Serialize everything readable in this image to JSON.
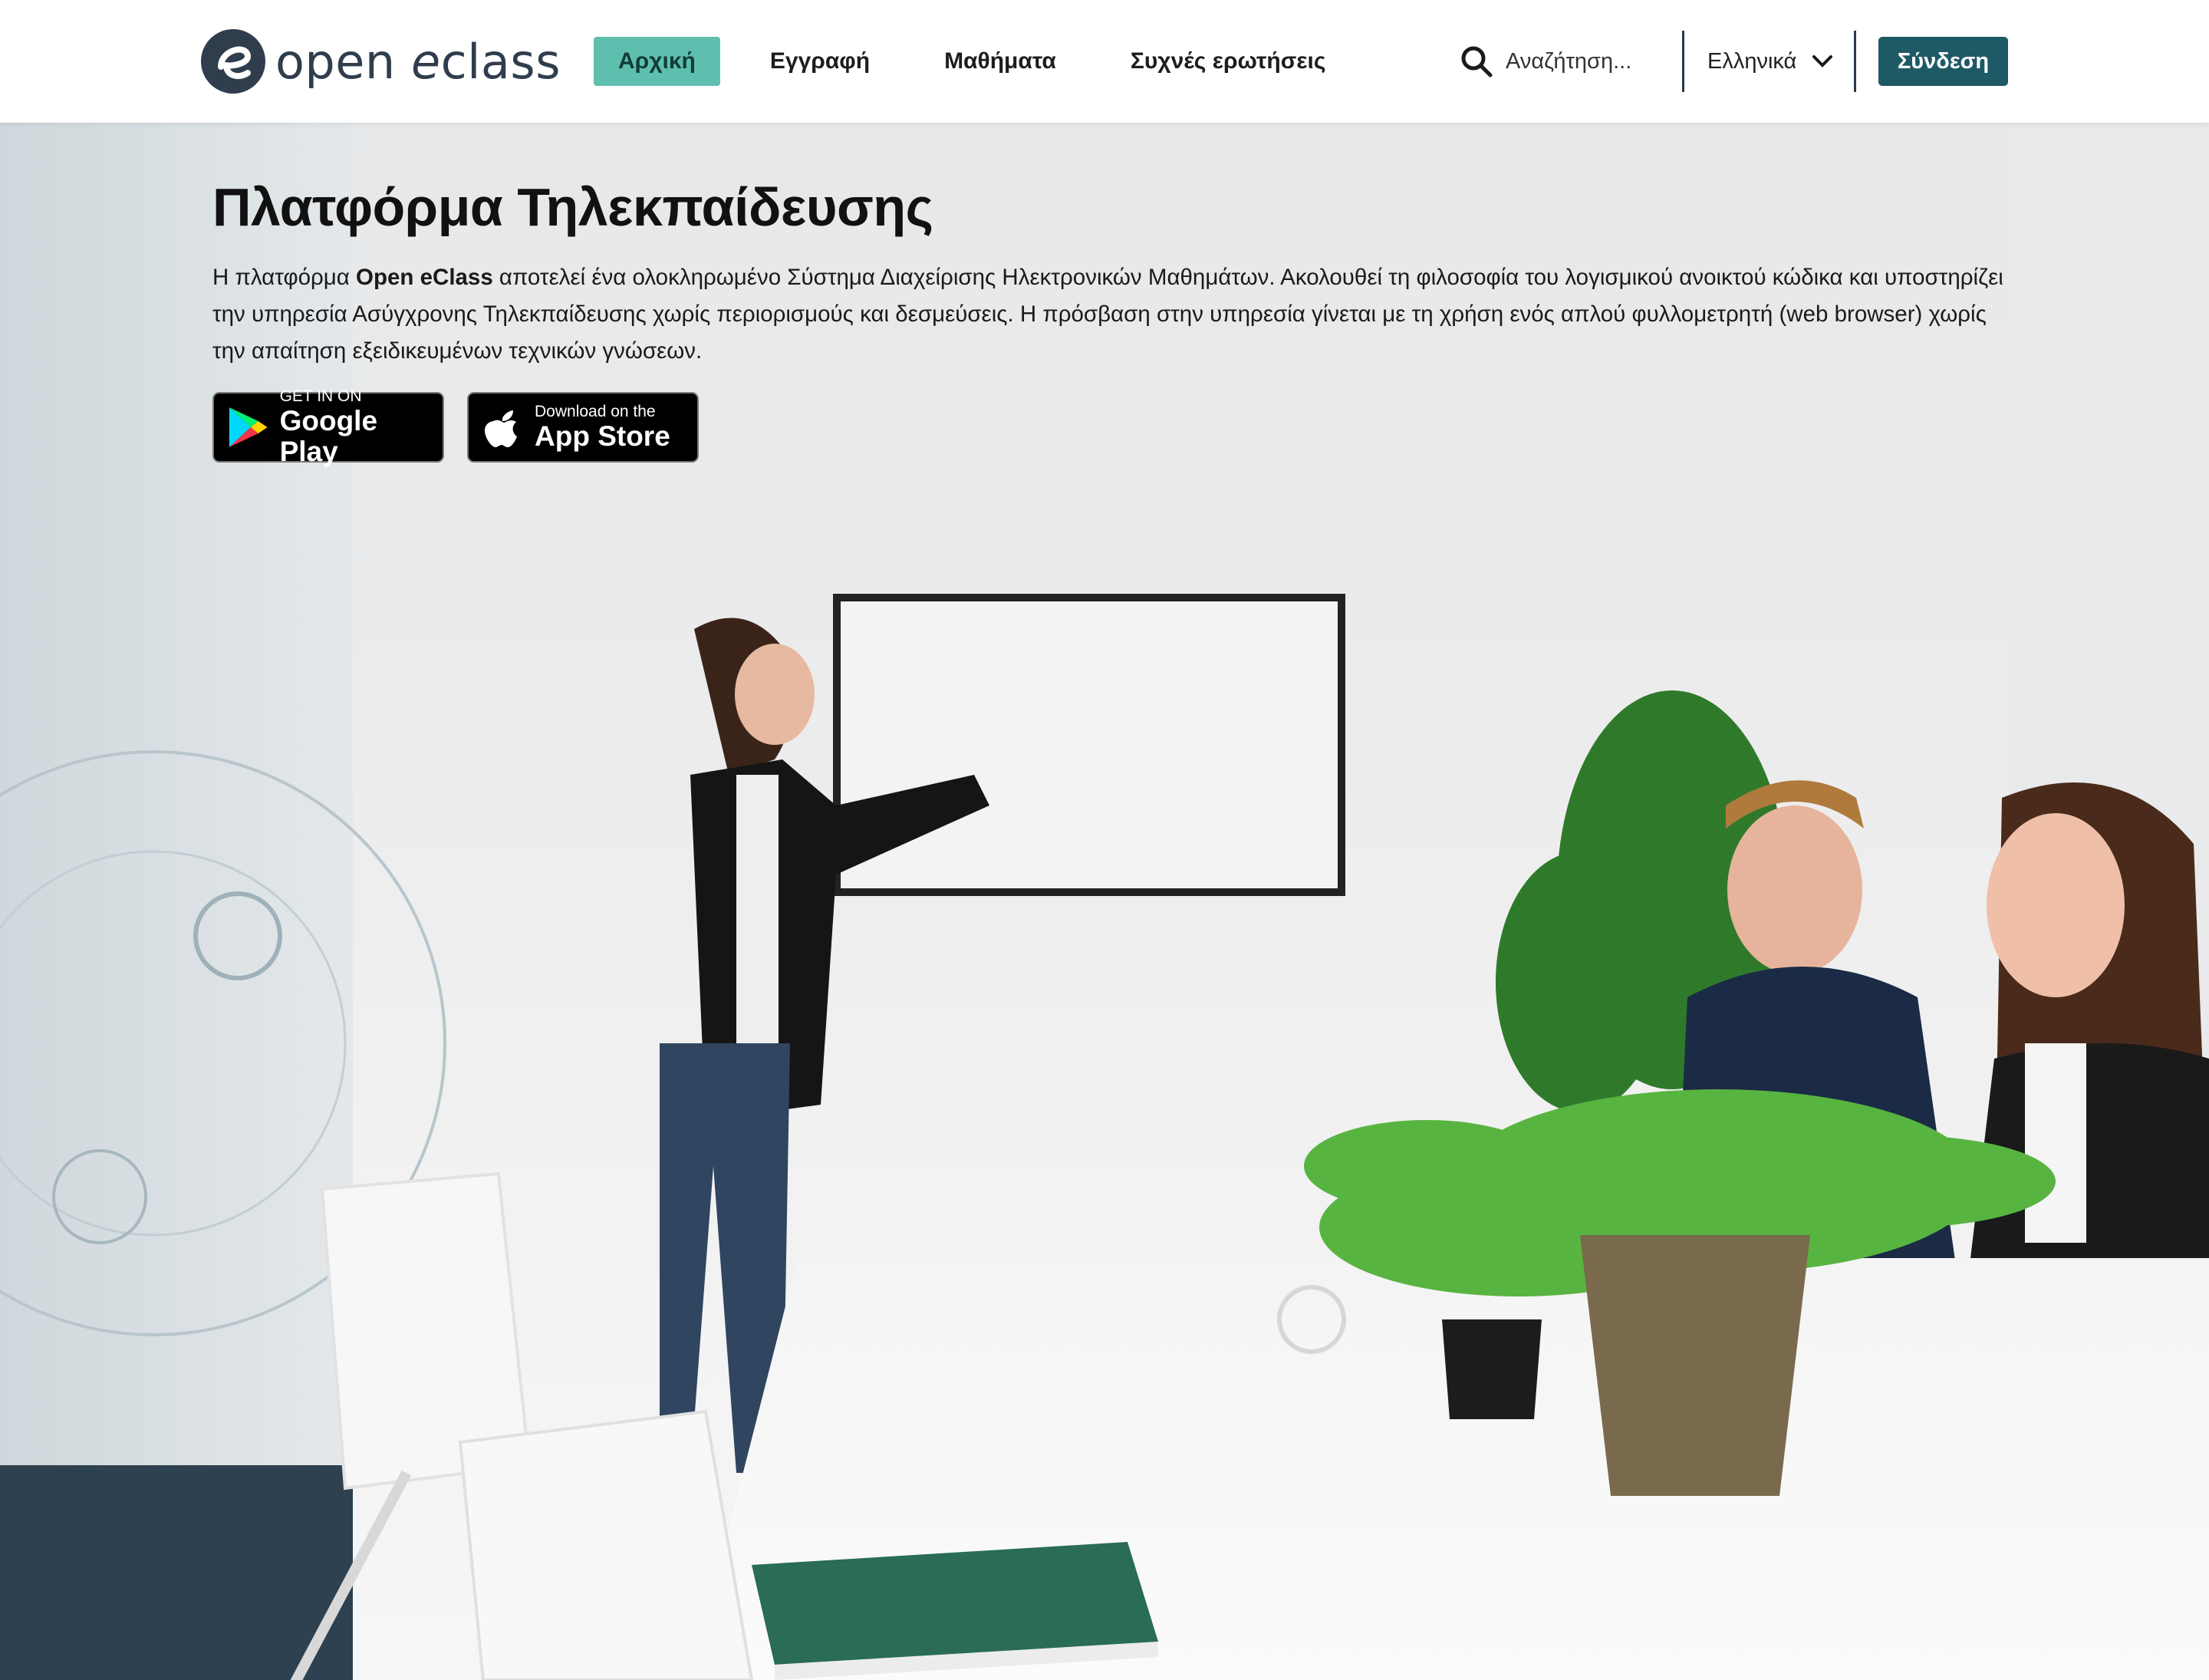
{
  "logo": {
    "brand_open": "open ",
    "brand_e": "e",
    "brand_class": "class"
  },
  "nav": {
    "items": [
      {
        "label": "Αρχική",
        "active": true
      },
      {
        "label": "Εγγραφή",
        "active": false
      },
      {
        "label": "Μαθήματα",
        "active": false
      },
      {
        "label": "Συχνές ερωτήσεις",
        "active": false
      }
    ]
  },
  "search": {
    "placeholder": "Αναζήτηση...",
    "icon": "search-icon"
  },
  "language": {
    "selected": "Ελληνικά",
    "icon": "chevron-down-icon"
  },
  "login": {
    "label": "Σύνδεση"
  },
  "hero": {
    "title": "Πλατφόρμα Τηλεκπαίδευσης",
    "desc_prefix": "Η πλατφόρμα ",
    "desc_brand": "Open eClass",
    "desc_rest": " αποτελεί ένα ολοκληρωμένο Σύστημα Διαχείρισης Ηλεκτρονικών Μαθημάτων. Ακολουθεί τη φιλοσοφία του λογισμικού ανοικτού κώδικα και υποστηρίζει την υπηρεσία Ασύγχρονης Τηλεκπαίδευσης χωρίς περιορισμούς και δεσμεύσεις. Η πρόσβαση στην υπηρεσία γίνεται με τη χρήση ενός απλού φυλλομετρητή (web browser) χωρίς την απαίτηση εξειδικευμένων τεχνικών γνώσεων."
  },
  "stores": {
    "google": {
      "small": "GET IN ON",
      "big": "Google Play",
      "icon": "google-play-icon"
    },
    "apple": {
      "small": "Download on the",
      "big": "App Store",
      "icon": "apple-icon"
    }
  },
  "colors": {
    "accent": "#5fbfae",
    "brand_dark": "#1e5966",
    "logo": "#2f3d4d"
  }
}
